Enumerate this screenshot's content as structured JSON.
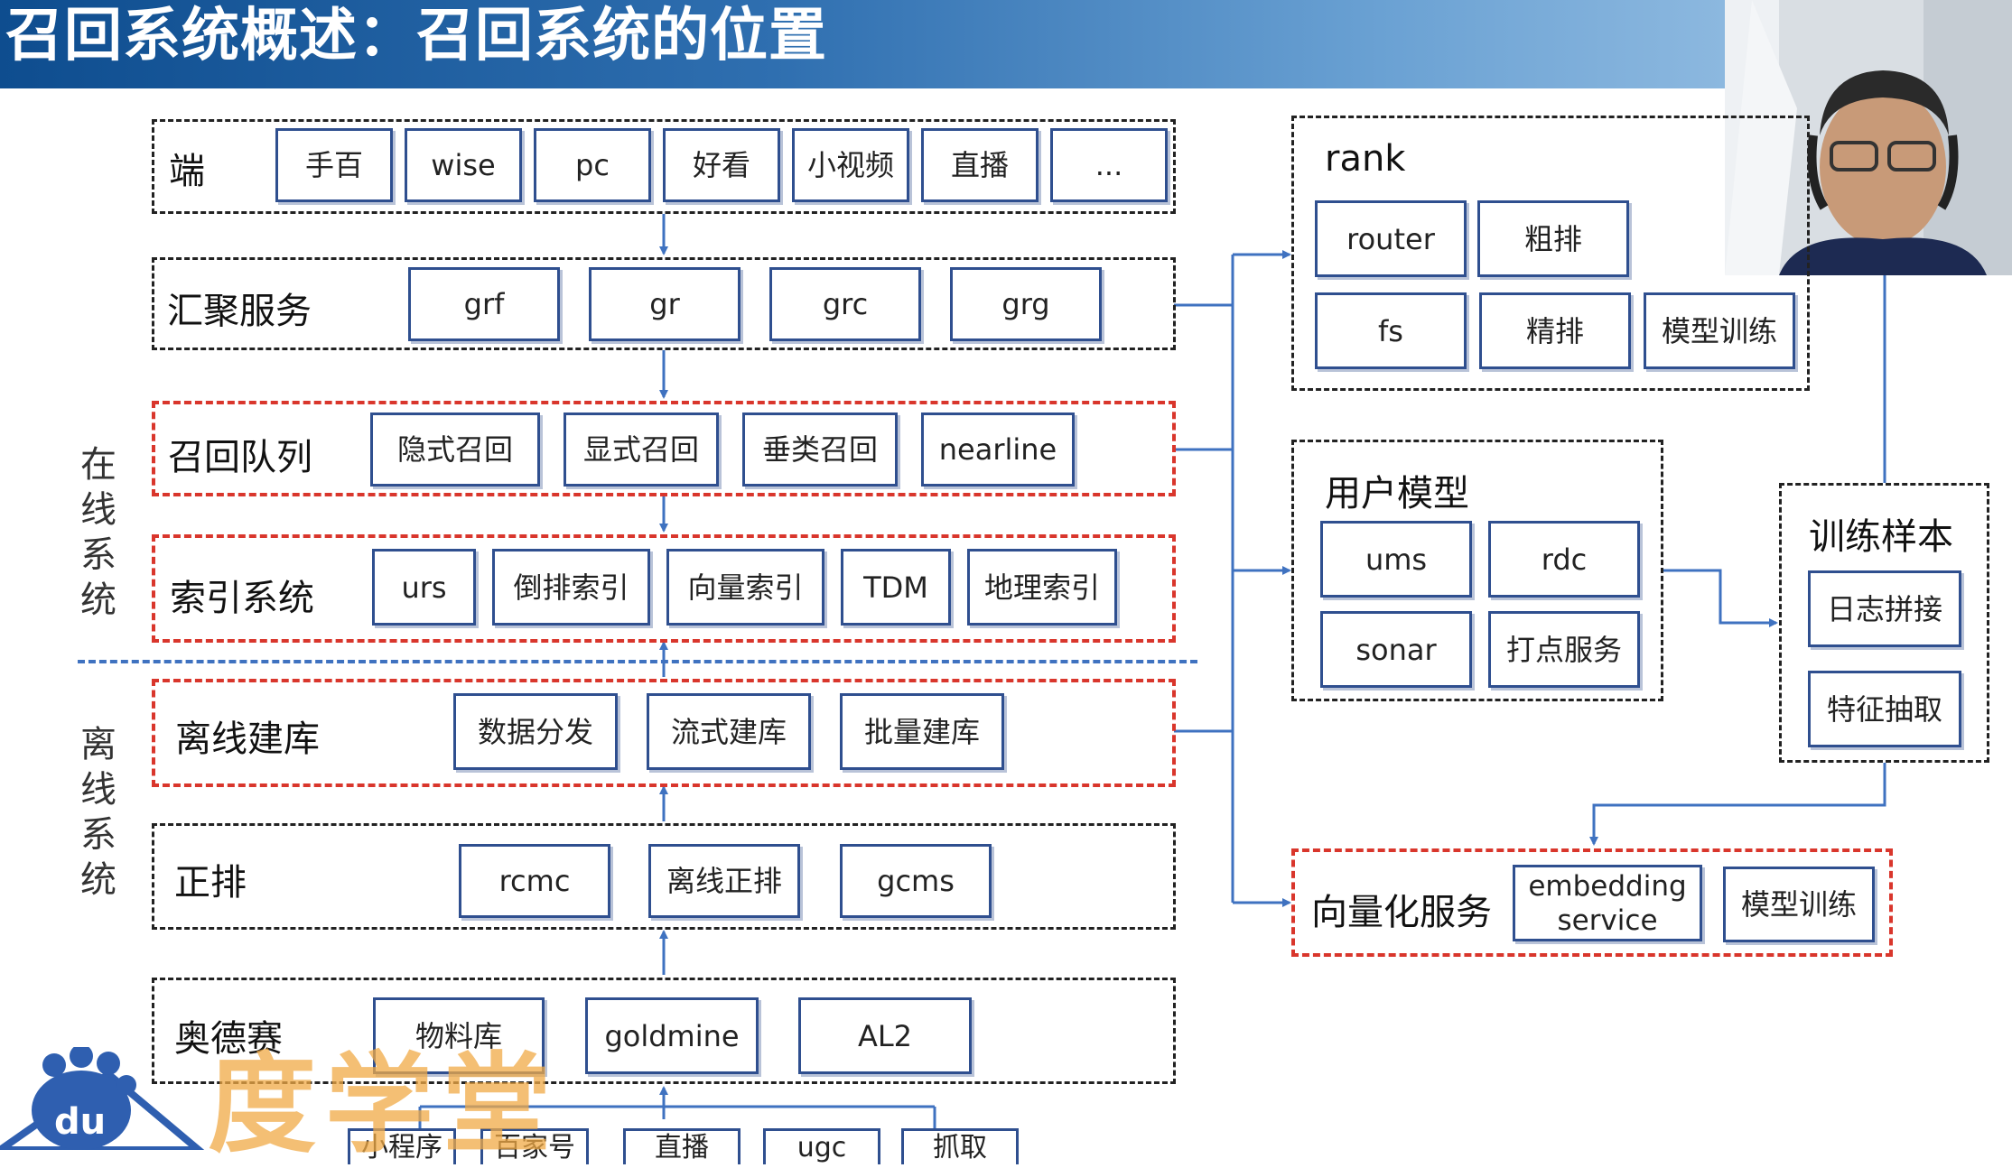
{
  "title": "召回系统概述：召回系统的位置",
  "side_labels": {
    "online": "在线系统",
    "offline": "离线系统"
  },
  "groups": {
    "duan": {
      "label": "端",
      "items": [
        "手百",
        "wise",
        "pc",
        "好看",
        "小视频",
        "直播",
        "..."
      ]
    },
    "huiju": {
      "label": "汇聚服务",
      "items": [
        "grf",
        "gr",
        "grc",
        "grg"
      ]
    },
    "zhaohui": {
      "label": "召回队列",
      "items": [
        "隐式召回",
        "显式召回",
        "垂类召回",
        "nearline"
      ]
    },
    "suoyin": {
      "label": "索引系统",
      "items": [
        "urs",
        "倒排索引",
        "向量索引",
        "TDM",
        "地理索引"
      ]
    },
    "lixian": {
      "label": "离线建库",
      "items": [
        "数据分发",
        "流式建库",
        "批量建库"
      ]
    },
    "zhengpai": {
      "label": "正排",
      "items": [
        "rcmc",
        "离线正排",
        "gcms"
      ]
    },
    "aodesai": {
      "label": "奥德赛",
      "items": [
        "物料库",
        "goldmine",
        "AL2"
      ]
    },
    "rank": {
      "label": "rank",
      "items": [
        "router",
        "粗排",
        "fs",
        "精排",
        "模型训练"
      ]
    },
    "user_model": {
      "label": "用户模型",
      "items": [
        "ums",
        "rdc",
        "sonar",
        "打点服务"
      ]
    },
    "train_sample": {
      "label": "训练样本",
      "items": [
        "日志拼接",
        "特征抽取"
      ]
    },
    "vector_service": {
      "label": "向量化服务",
      "items": [
        "embedding service",
        "模型训练"
      ]
    }
  },
  "bottom_row": [
    "小程序",
    "百家号",
    "直播",
    "ugc",
    "抓取"
  ],
  "watermark": "度学堂",
  "logo_text": "du",
  "colors": {
    "accent_blue": "#3f72c0",
    "box_border": "#2f4f8f",
    "red_dashed": "#d9362c",
    "title_bar": "#1d5ea3"
  }
}
